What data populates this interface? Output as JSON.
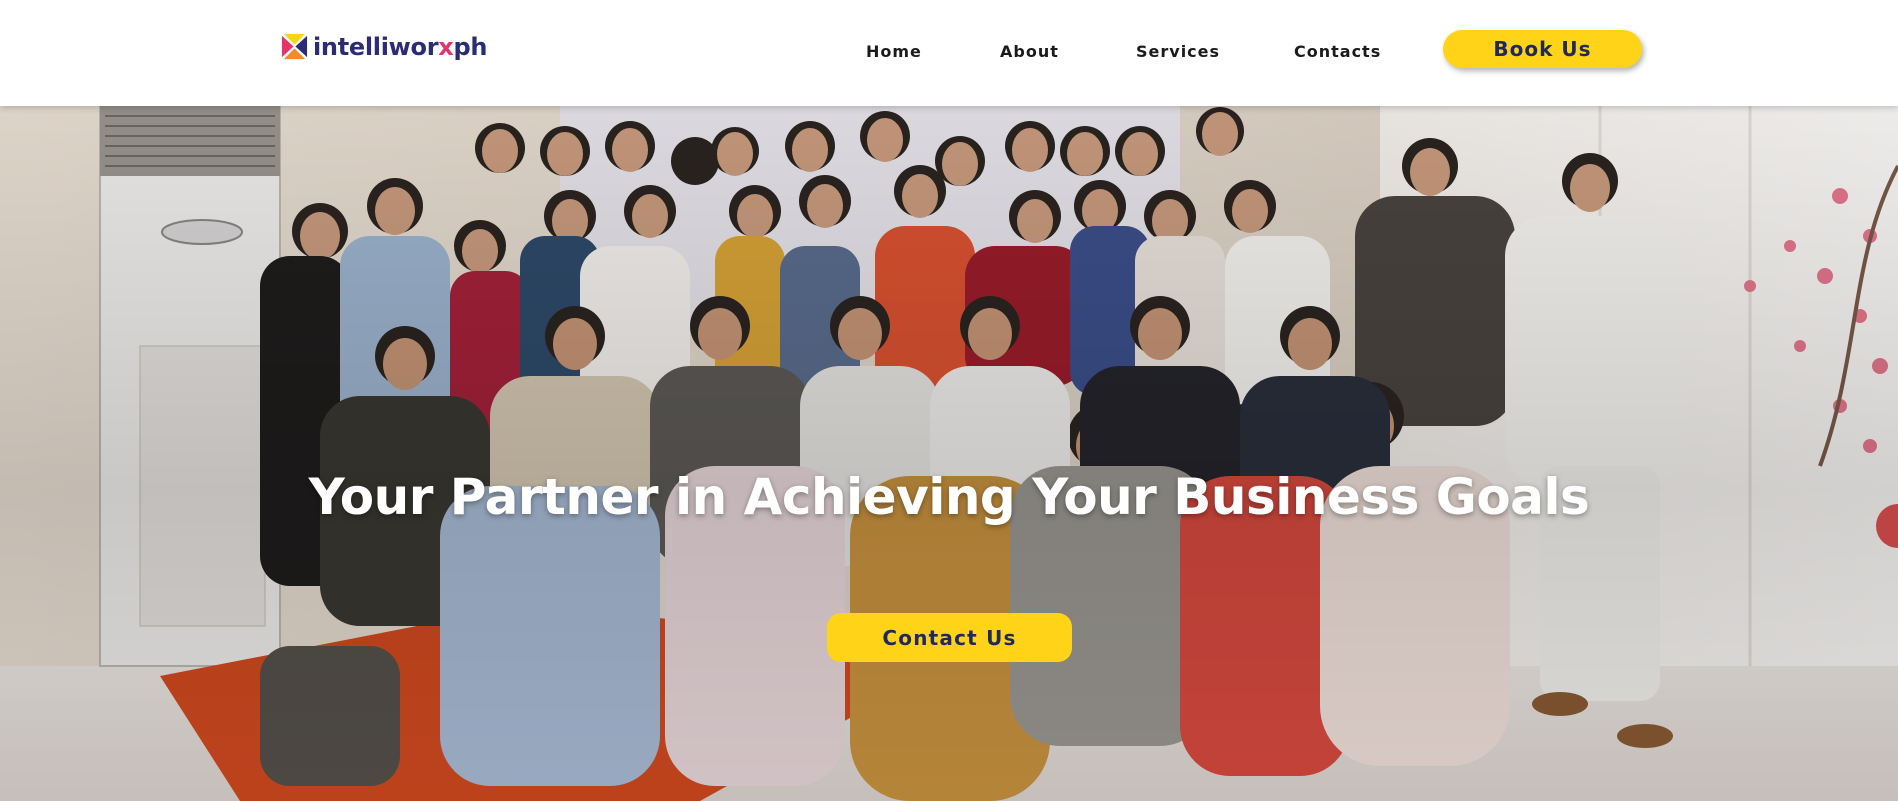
{
  "brand": {
    "name_main": "intelliworx",
    "name_x": "x",
    "name_suffix": " ph",
    "colors": {
      "navy": "#2b2c75",
      "pink": "#e8336a",
      "yellow": "#ffd418",
      "button_text": "#1f2a5c"
    },
    "logo_icon": "intelliworx-logo-icon"
  },
  "nav": {
    "items": [
      {
        "label": "Home"
      },
      {
        "label": "About"
      },
      {
        "label": "Services"
      },
      {
        "label": "Contacts"
      }
    ],
    "cta_label": "Book Us"
  },
  "hero": {
    "title": "Your Partner in Achieving Your Business Goals",
    "cta_label": "Contact Us"
  }
}
